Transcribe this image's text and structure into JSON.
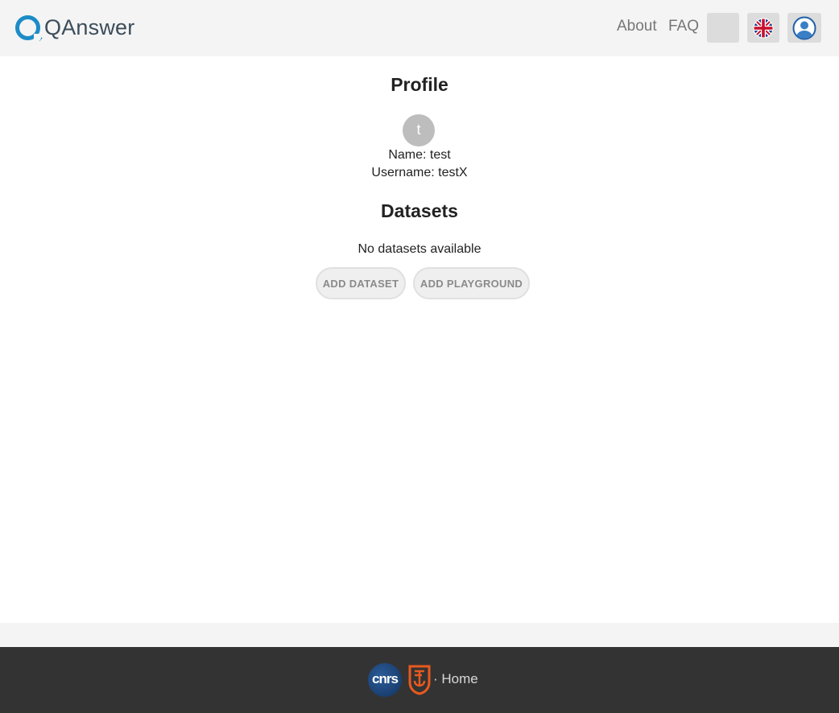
{
  "header": {
    "logo_text": "QAnswer",
    "nav": {
      "about": "About",
      "faq": "FAQ"
    },
    "icons": {
      "language": "uk-flag-icon",
      "user": "user-avatar-icon"
    }
  },
  "profile": {
    "title": "Profile",
    "avatar_initial": "t",
    "name_line": "Name: test",
    "username_line": "Username: testX"
  },
  "datasets": {
    "title": "Datasets",
    "empty_text": "No datasets available",
    "add_dataset_label": "ADD DATASET",
    "add_playground_label": "ADD PLAYGROUND"
  },
  "footer": {
    "cnrs_logo_text": "cnrs",
    "home_link": "· Home"
  },
  "colors": {
    "brand_blue": "#1c8cc7",
    "header_bg": "#f4f4f4",
    "footer_bg": "#333333"
  }
}
